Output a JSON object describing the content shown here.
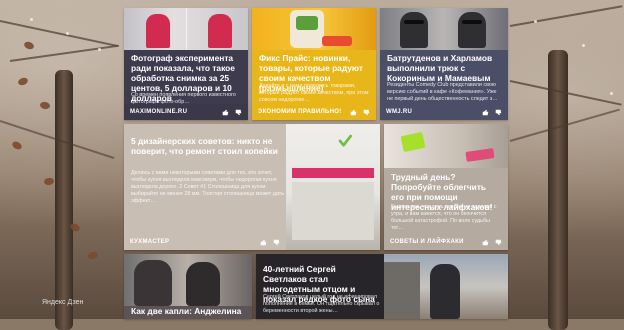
{
  "brand": {
    "label": "Яндекс Дзен"
  },
  "cards": [
    {
      "id": "maxim",
      "title": "Фотограф экспериментa ради показала, что такое обработка снимка за 25 центов, 5 долларов и 10 долларов",
      "description": "Со времен появления первого известного фотографа фото-обр…",
      "source": "MAXIMONLINE.RU",
      "bg": "#3f3b4f",
      "text_color": "#ffffff"
    },
    {
      "id": "fixprice",
      "title": "Фикс Прайс: новинки, товары, которые радуют своим качеством (размышление)",
      "description": "Давайте я с вами поделюсь товарами, которые радуют своим качеством, при этом совсем недорогие…",
      "source": "ЭКОНОМИМ ПРАВИЛЬНО!",
      "bg": "#e9b61a",
      "text_color": "#ffffff"
    },
    {
      "id": "wmj",
      "title": "Батрутденов и Харламов выполнили трюк с Кокориным и Мамаевым",
      "description": "Резиденты Comedy Club представили свою версию событий в кафе «Кофемания». Уже не первый день общественность следит з…",
      "source": "WMJ.RU",
      "bg": "#4a4e67",
      "text_color": "#ffffff"
    },
    {
      "id": "kukhster",
      "title": "5 дизайнерских советов: никто не поверит, что ремонт стоил копейки",
      "description": "Делюсь с вами некоторыми советами для тех, кто хочет, чтобы кухня выглядела максимум, чтобы недорогая кухня выглядела дорого. 2 Совет #1 Столешница для кухни выбирайте не менее 28 мм. Толстая столешница может дать эффект…",
      "source": "КУХМАСТЕР",
      "bg": "#c9beb3",
      "text_color": "#ffffff"
    },
    {
      "id": "lifehacks",
      "title": "Трудный день? Попробуйте облегчить его при помощи интересных лайфхаков!",
      "description": "Бывает так, что день совсем не задался с утра, и вам кажется, что он окончится большой катастрофой. По воле судьбы тог…",
      "source": "СОВЕТЫ И ЛАЙФХАКИ",
      "bg": "#b4aa9f",
      "text_color": "#ffffff"
    },
    {
      "id": "kak",
      "title": "Как две капли: Анджелина",
      "bg": "#5b5356",
      "text_color": "#ffffff"
    },
    {
      "id": "svetlakov",
      "title": "40-летний Сергей Светлаков стал многодетным отцом и показал редкое фото сына",
      "description": "Сергей Светлаков целый год не афишировал пополнение в семье. Он тщательно скрывал о беременности второй жены…",
      "bg": "#3d3a3f",
      "text_color": "#ffffff"
    }
  ],
  "colors": {
    "accent_green": "#6dc04c",
    "pink": "#d7326a"
  }
}
